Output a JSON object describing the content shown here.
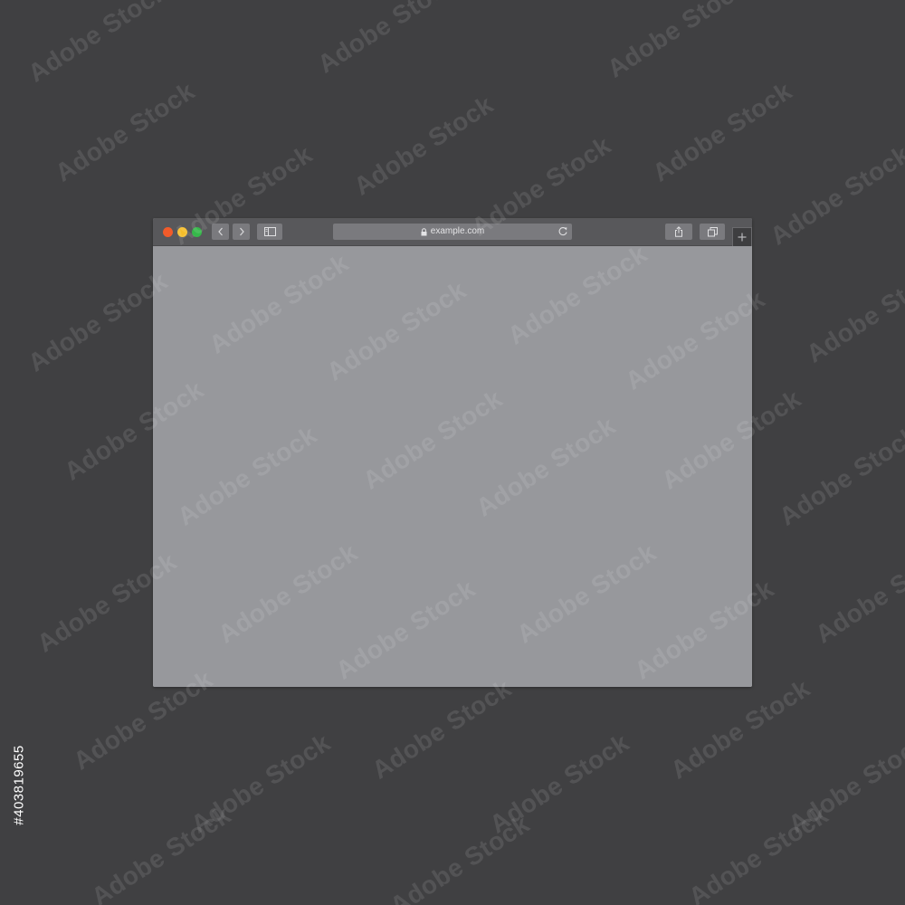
{
  "browser": {
    "address_bar": {
      "url": "example.com"
    },
    "new_tab_label": "+"
  },
  "watermark": {
    "brand": "Adobe Stock",
    "image_number": "#403819655"
  },
  "colors": {
    "background": "#404042",
    "toolbar": "#58585b",
    "content": "#97989c",
    "close_button": "#f25b2a",
    "minimize_button": "#f5bd29",
    "zoom_button": "#36b84a"
  }
}
